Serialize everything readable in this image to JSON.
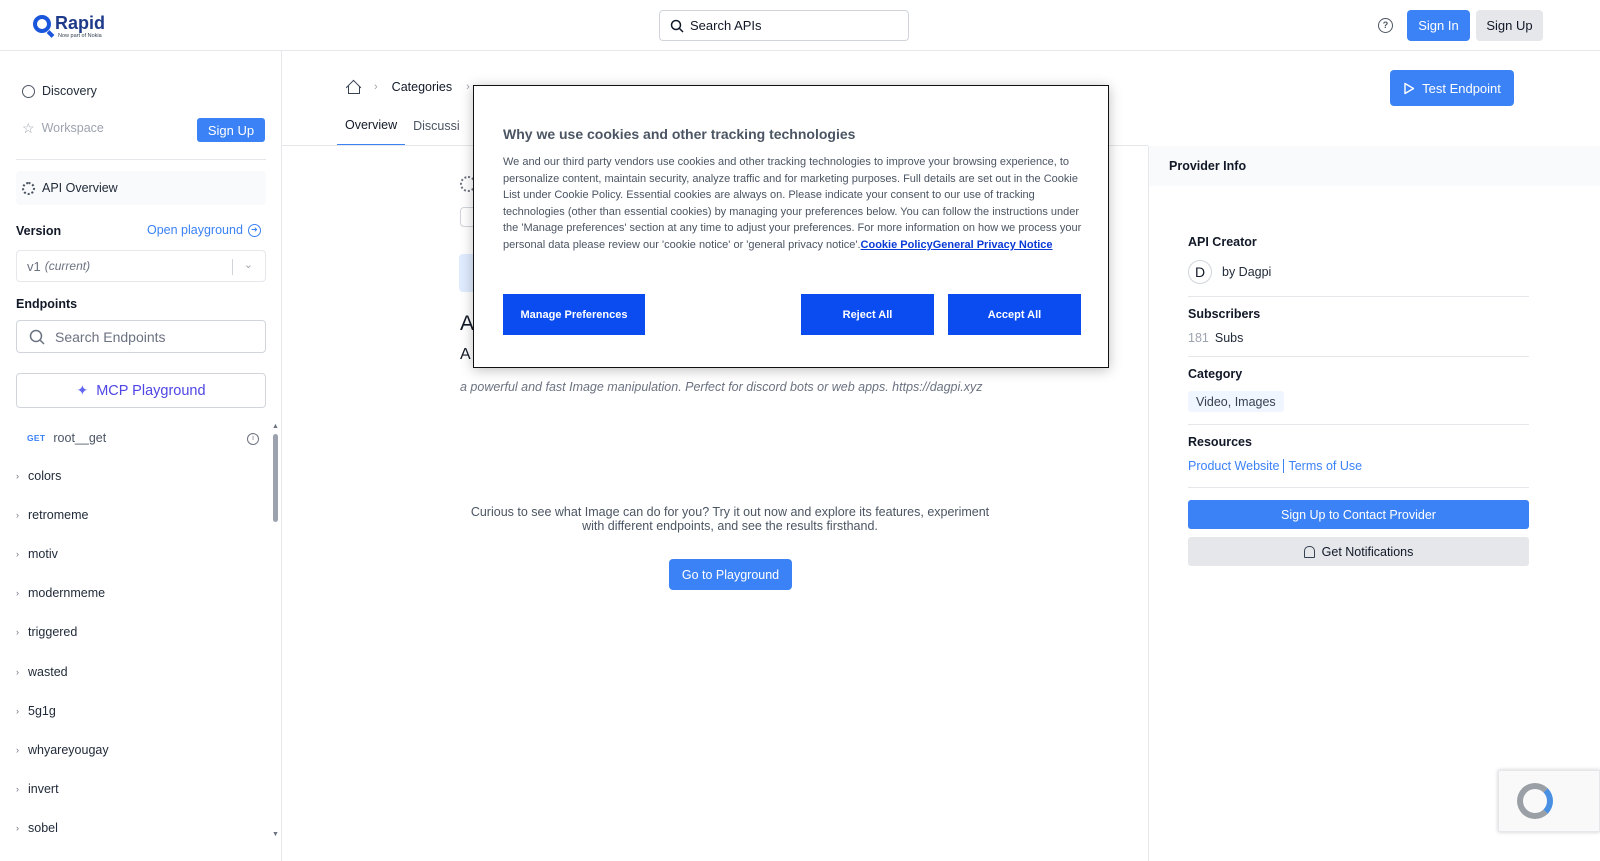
{
  "header": {
    "logo_word": "Rapid",
    "logo_sub": "Now part of Nokia",
    "search_placeholder": "Search APIs",
    "help_icon_glyph": "?",
    "signin_label": "Sign In",
    "signup_label": "Sign Up"
  },
  "sidebar": {
    "discovery_label": "Discovery",
    "workspace_label": "Workspace",
    "signup_label": "Sign Up",
    "api_overview_label": "API Overview",
    "version_label": "Version",
    "open_playground_label": "Open playground",
    "version_value": "v1",
    "version_note": "(current)",
    "endpoints_label": "Endpoints",
    "search_endpoints_placeholder": "Search Endpoints",
    "mcp_label": "MCP Playground",
    "get_method": "GET",
    "get_endpoint": "root__get",
    "endpoint_groups": [
      "colors",
      "retromeme",
      "motiv",
      "modernmeme",
      "triggered",
      "wasted",
      "5g1g",
      "whyareyougay",
      "invert",
      "sobel"
    ]
  },
  "main": {
    "breadcrumb_categories": "Categories",
    "tabs": [
      "Overview",
      "Discussi"
    ],
    "test_endpoint_label": "Test Endpoint",
    "partial_title": "A",
    "partial_subtitle": "A",
    "description": "a powerful and fast Image manipulation. Perfect for discord bots or web apps. https://dagpi.xyz",
    "curious_text": "Curious to see what Image can do for you? Try it out now and explore its features, experiment with different endpoints, and see the results firsthand.",
    "go_playground_label": "Go to Playground"
  },
  "provider": {
    "header": "Provider Info",
    "creator_label": "API Creator",
    "creator_initial": "D",
    "creator_name": "by Dagpi",
    "subscribers_label": "Subscribers",
    "subscribers_count": "181",
    "subscribers_unit": "Subs",
    "category_label": "Category",
    "category_value": "Video, Images",
    "resources_label": "Resources",
    "product_website": "Product Website",
    "terms_of_use": "Terms of Use",
    "contact_label": "Sign Up to Contact Provider",
    "notify_label": "Get Notifications"
  },
  "cookie": {
    "title": "Why we use cookies and other tracking technologies",
    "body": "We and our third party vendors use cookies and other tracking technologies to improve your browsing experience, to personalize content, maintain security, analyze traffic and for marketing purposes. Full details are set out in the Cookie List under Cookie Policy. Essential cookies are always on. Please indicate your consent to our use of tracking technologies (other than essential cookies) by managing your preferences below. You can follow the instructions under the 'Manage preferences' section at any time to adjust your preferences. For more information on how we process your personal data please review our 'cookie notice' or 'general privacy notice'.",
    "link_cookie_policy": "Cookie Policy",
    "link_privacy": "General Privacy Notice",
    "manage_label": "Manage Preferences",
    "reject_label": "Reject All",
    "accept_label": "Accept All"
  },
  "colors": {
    "accent": "#3b82f6",
    "cookie_button": "#0a4cf0",
    "mcp": "#4f46e5"
  },
  "icons": [
    "search-icon",
    "help-icon",
    "compass-icon",
    "star-icon",
    "gear-icon",
    "circle-arrow-icon",
    "chevron-down-icon",
    "sparkle-icon",
    "info-icon",
    "chevron-right-icon",
    "home-icon",
    "play-icon",
    "bell-icon",
    "recaptcha-icon"
  ]
}
